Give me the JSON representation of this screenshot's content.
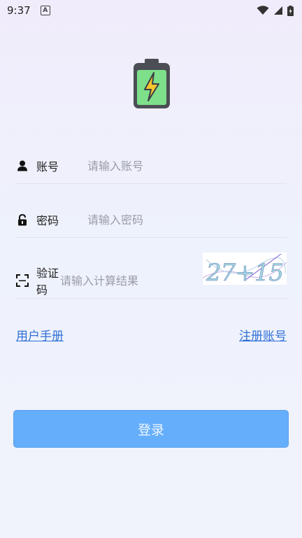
{
  "status": {
    "time": "9:37",
    "badge": "A"
  },
  "form": {
    "username": {
      "label": "账号",
      "placeholder": "请输入账号"
    },
    "password": {
      "label": "密码",
      "placeholder": "请输入密码"
    },
    "captcha": {
      "label": "验证码",
      "placeholder": "请输入计算结果",
      "image_text": "27+15"
    }
  },
  "links": {
    "manual": "用户手册",
    "register": "注册账号"
  },
  "login_button": "登录"
}
